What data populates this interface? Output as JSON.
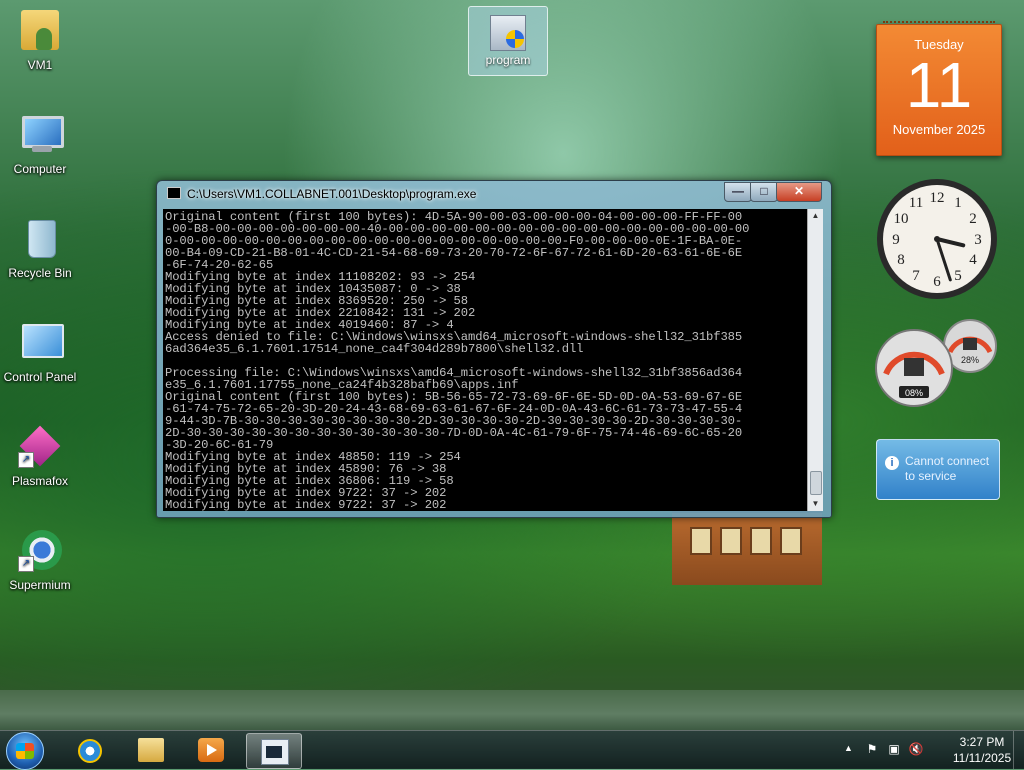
{
  "desktop": {
    "icons": [
      {
        "label": "VM1",
        "icon": "user-folder-icon"
      },
      {
        "label": "Computer",
        "icon": "computer-icon"
      },
      {
        "label": "Recycle Bin",
        "icon": "recycle-bin-icon"
      },
      {
        "label": "Control Panel",
        "icon": "control-panel-icon"
      },
      {
        "label": "Plasmafox",
        "icon": "plasmafox-icon"
      },
      {
        "label": "Supermium",
        "icon": "supermium-icon"
      }
    ],
    "selected_icon": {
      "label": "program",
      "icon": "program-exe-icon"
    }
  },
  "gadgets": {
    "calendar": {
      "weekday": "Tuesday",
      "day": "11",
      "month_year": "November 2025"
    },
    "clock": {
      "hour": 3,
      "minute": 27
    },
    "cpu_meter": {
      "cpu": "08%",
      "memory": "28%"
    },
    "status": {
      "message_line1": "Cannot connect",
      "message_line2": "to service"
    }
  },
  "console": {
    "title": "C:\\Users\\VM1.COLLABNET.001\\Desktop\\program.exe",
    "controls": {
      "minimize": "—",
      "maximize": "□",
      "close": "✕"
    },
    "lines": [
      "Original content (first 100 bytes): 4D-5A-90-00-03-00-00-00-04-00-00-00-FF-FF-00",
      "-00-B8-00-00-00-00-00-00-00-40-00-00-00-00-00-00-00-00-00-00-00-00-00-00-00-00-00",
      "0-00-00-00-00-00-00-00-00-00-00-00-00-00-00-00-00-00-00-F0-00-00-00-0E-1F-BA-0E-",
      "00-B4-09-CD-21-B8-01-4C-CD-21-54-68-69-73-20-70-72-6F-67-72-61-6D-20-63-61-6E-6E",
      "-6F-74-20-62-65",
      "Modifying byte at index 11108202: 93 -> 254",
      "Modifying byte at index 10435087: 0 -> 38",
      "Modifying byte at index 8369520: 250 -> 58",
      "Modifying byte at index 2210842: 131 -> 202",
      "Modifying byte at index 4019460: 87 -> 4",
      "Access denied to file: C:\\Windows\\winsxs\\amd64_microsoft-windows-shell32_31bf385",
      "6ad364e35_6.1.7601.17514_none_ca4f304d289b7800\\shell32.dll",
      "",
      "Processing file: C:\\Windows\\winsxs\\amd64_microsoft-windows-shell32_31bf3856ad364",
      "e35_6.1.7601.17755_none_ca24f4b328bafb69\\apps.inf",
      "Original content (first 100 bytes): 5B-56-65-72-73-69-6F-6E-5D-0D-0A-53-69-67-6E",
      "-61-74-75-72-65-20-3D-20-24-43-68-69-63-61-67-6F-24-0D-0A-43-6C-61-73-73-47-55-4",
      "9-44-3D-7B-30-30-30-30-30-30-30-30-2D-30-30-30-30-2D-30-30-30-30-2D-30-30-30-30-",
      "2D-30-30-30-30-30-30-30-30-30-30-30-30-7D-0D-0A-4C-61-79-6F-75-74-46-69-6C-65-20",
      "-3D-20-6C-61-79",
      "Modifying byte at index 48850: 119 -> 254",
      "Modifying byte at index 45890: 76 -> 38",
      "Modifying byte at index 36806: 119 -> 58",
      "Modifying byte at index 9722: 37 -> 202",
      "Modifying byte at index 9722: 37 -> 202"
    ]
  },
  "taskbar": {
    "pinned": [
      {
        "name": "internet-explorer",
        "icon": "internet-explorer-icon"
      },
      {
        "name": "windows-explorer",
        "icon": "folder-explorer-icon"
      },
      {
        "name": "media-player",
        "icon": "media-player-icon"
      },
      {
        "name": "program-console",
        "icon": "console-window-icon",
        "active": true
      }
    ],
    "tray": {
      "time": "3:27 PM",
      "date": "11/11/2025"
    }
  }
}
